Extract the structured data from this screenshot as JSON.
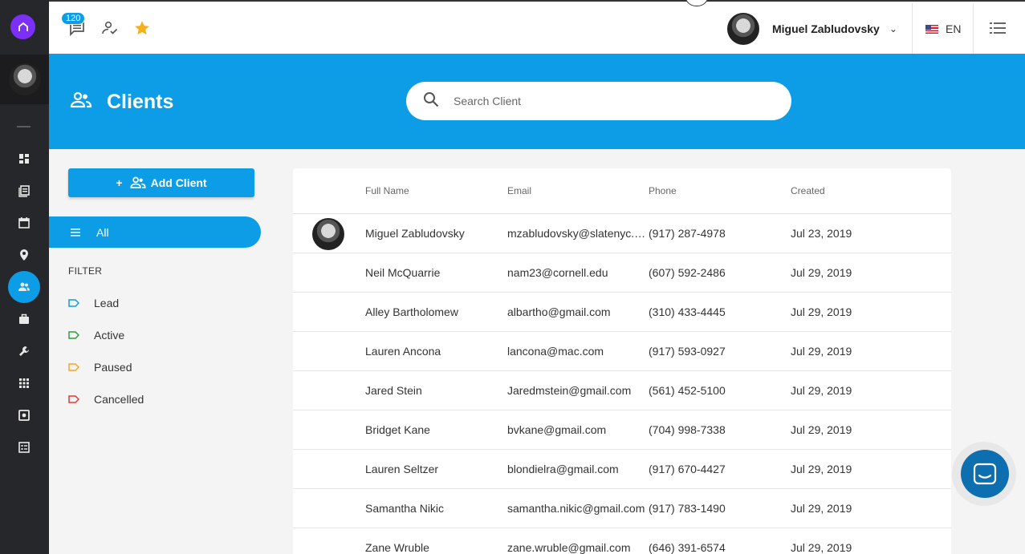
{
  "topbar": {
    "message_badge": "120",
    "user_name": "Miguel Zabludovsky",
    "language": "EN"
  },
  "header": {
    "title": "Clients",
    "search_placeholder": "Search Client"
  },
  "sidebar": {
    "add_button": "Add Client",
    "all_label": "All",
    "filter_title": "FILTER",
    "filters": [
      {
        "label": "Lead",
        "color": "#0d9de6"
      },
      {
        "label": "Active",
        "color": "#2e9e3e"
      },
      {
        "label": "Paused",
        "color": "#f5a623"
      },
      {
        "label": "Cancelled",
        "color": "#e53935"
      }
    ]
  },
  "table": {
    "columns": [
      "Full Name",
      "Email",
      "Phone",
      "Created"
    ],
    "rows": [
      {
        "name": "Miguel Zabludovsky",
        "email": "mzabludovsky@slatenyc.com",
        "phone": "(917) 287-4978",
        "created": "Jul 23, 2019"
      },
      {
        "name": "Neil McQuarrie",
        "email": "nam23@cornell.edu",
        "phone": "(607) 592-2486",
        "created": "Jul 29, 2019"
      },
      {
        "name": "Alley Bartholomew",
        "email": "albartho@gmail.com",
        "phone": "(310) 433-4445",
        "created": "Jul 29, 2019"
      },
      {
        "name": "Lauren Ancona",
        "email": "lancona@mac.com",
        "phone": "(917) 593-0927",
        "created": "Jul 29, 2019"
      },
      {
        "name": "Jared Stein",
        "email": "Jaredmstein@gmail.com",
        "phone": "(561) 452-5100",
        "created": "Jul 29, 2019"
      },
      {
        "name": "Bridget Kane",
        "email": "bvkane@gmail.com",
        "phone": "(704) 998-7338",
        "created": "Jul 29, 2019"
      },
      {
        "name": "Lauren Seltzer",
        "email": "blondielra@gmail.com",
        "phone": "(917) 670-4427",
        "created": "Jul 29, 2019"
      },
      {
        "name": "Samantha Nikic",
        "email": "samantha.nikic@gmail.com",
        "phone": "(917) 783-1490",
        "created": "Jul 29, 2019"
      },
      {
        "name": "Zane Wruble",
        "email": "zane.wruble@gmail.com",
        "phone": "(646) 391-6574",
        "created": "Jul 29, 2019"
      }
    ]
  },
  "colors": {
    "accent": "#0d9de6",
    "rail": "#26272b",
    "brand": "#7b2ff7"
  },
  "icons": [
    "home-icon",
    "dashboard-icon",
    "documents-icon",
    "calendar-icon",
    "location-icon",
    "clients-icon",
    "briefcase-icon",
    "tools-icon",
    "apps-icon",
    "gallery-icon",
    "forms-icon",
    "chat-icon",
    "user-check-icon",
    "star-icon",
    "search-icon",
    "menu-icon"
  ]
}
